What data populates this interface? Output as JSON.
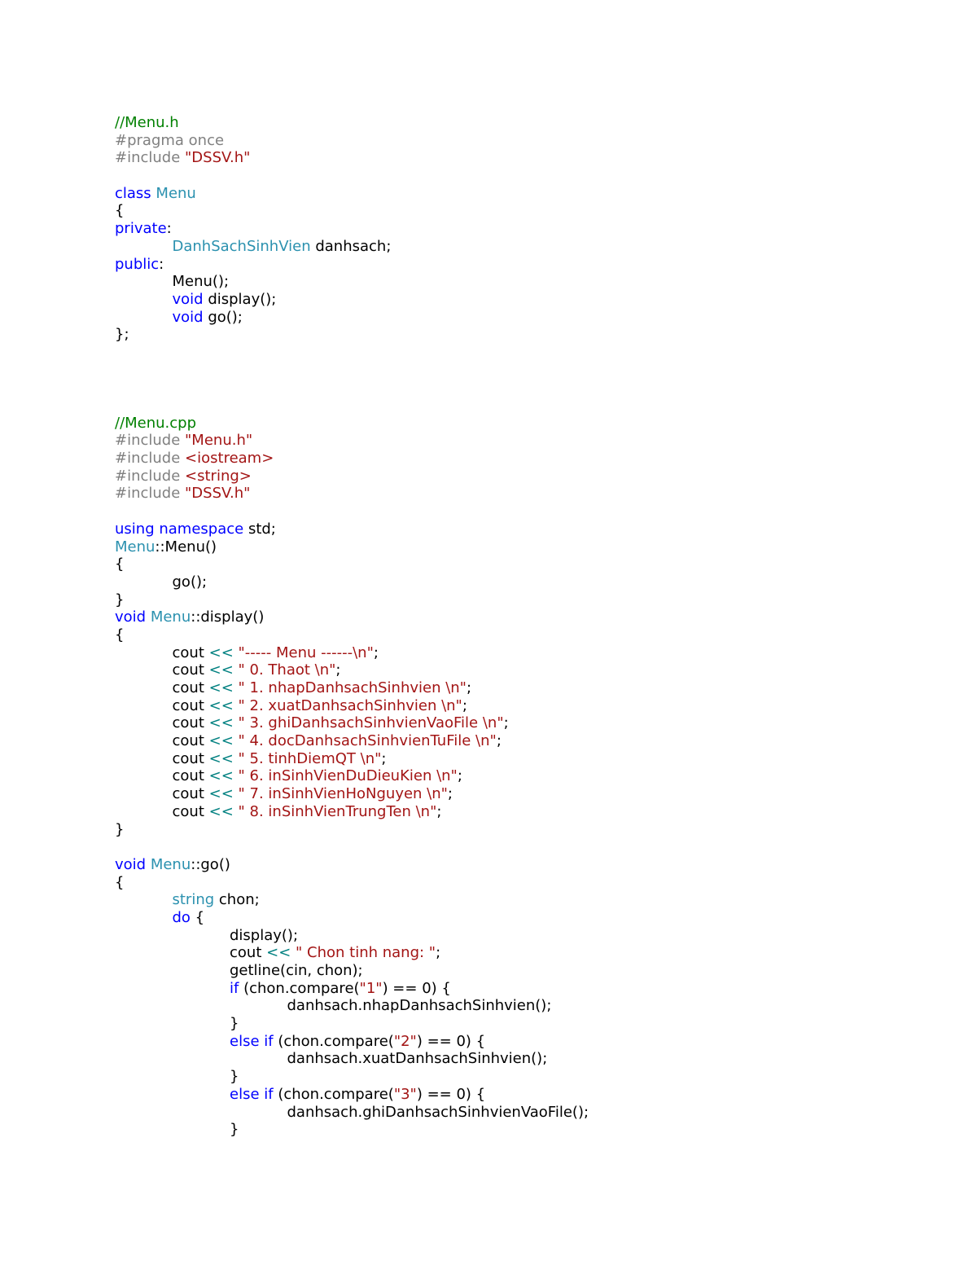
{
  "document": {
    "lines": [
      [
        {
          "t": "com",
          "s": "//Menu.h"
        }
      ],
      [
        {
          "t": "pre",
          "s": "#pragma once"
        }
      ],
      [
        {
          "t": "pre",
          "s": "#include "
        },
        {
          "t": "str",
          "s": "\"DSSV.h\""
        }
      ],
      [],
      [
        {
          "t": "kw",
          "s": "class"
        },
        {
          "t": "plain",
          "s": " "
        },
        {
          "t": "type",
          "s": "Menu"
        }
      ],
      [
        {
          "t": "plain",
          "s": "{"
        }
      ],
      [
        {
          "t": "kw",
          "s": "private"
        },
        {
          "t": "plain",
          "s": ":"
        }
      ],
      [
        {
          "t": "plain",
          "s": "\t"
        },
        {
          "t": "type",
          "s": "DanhSachSinhVien"
        },
        {
          "t": "plain",
          "s": " danhsach;"
        }
      ],
      [
        {
          "t": "kw",
          "s": "public"
        },
        {
          "t": "plain",
          "s": ":"
        }
      ],
      [
        {
          "t": "plain",
          "s": "\tMenu();"
        }
      ],
      [
        {
          "t": "plain",
          "s": "\t"
        },
        {
          "t": "kw",
          "s": "void"
        },
        {
          "t": "plain",
          "s": " display();"
        }
      ],
      [
        {
          "t": "plain",
          "s": "\t"
        },
        {
          "t": "kw",
          "s": "void"
        },
        {
          "t": "plain",
          "s": " go();"
        }
      ],
      [
        {
          "t": "plain",
          "s": "};"
        }
      ],
      [],
      [],
      [],
      [],
      [
        {
          "t": "com",
          "s": "//Menu.cpp"
        }
      ],
      [
        {
          "t": "pre",
          "s": "#include "
        },
        {
          "t": "str",
          "s": "\"Menu.h\""
        }
      ],
      [
        {
          "t": "pre",
          "s": "#include "
        },
        {
          "t": "str",
          "s": "<iostream>"
        }
      ],
      [
        {
          "t": "pre",
          "s": "#include "
        },
        {
          "t": "str",
          "s": "<string>"
        }
      ],
      [
        {
          "t": "pre",
          "s": "#include "
        },
        {
          "t": "str",
          "s": "\"DSSV.h\""
        }
      ],
      [],
      [
        {
          "t": "kw",
          "s": "using"
        },
        {
          "t": "plain",
          "s": " "
        },
        {
          "t": "kw",
          "s": "namespace"
        },
        {
          "t": "plain",
          "s": " std;"
        }
      ],
      [
        {
          "t": "type",
          "s": "Menu"
        },
        {
          "t": "plain",
          "s": "::Menu()"
        }
      ],
      [
        {
          "t": "plain",
          "s": "{"
        }
      ],
      [
        {
          "t": "plain",
          "s": "\tgo();"
        }
      ],
      [
        {
          "t": "plain",
          "s": "}"
        }
      ],
      [
        {
          "t": "kw",
          "s": "void"
        },
        {
          "t": "plain",
          "s": " "
        },
        {
          "t": "type",
          "s": "Menu"
        },
        {
          "t": "plain",
          "s": "::display()"
        }
      ],
      [
        {
          "t": "plain",
          "s": "{"
        }
      ],
      [
        {
          "t": "plain",
          "s": "\tcout "
        },
        {
          "t": "op",
          "s": "<<"
        },
        {
          "t": "plain",
          "s": " "
        },
        {
          "t": "str",
          "s": "\"----- Menu ------\\n\""
        },
        {
          "t": "plain",
          "s": ";"
        }
      ],
      [
        {
          "t": "plain",
          "s": "\tcout "
        },
        {
          "t": "op",
          "s": "<<"
        },
        {
          "t": "plain",
          "s": " "
        },
        {
          "t": "str",
          "s": "\" 0. Thaot \\n\""
        },
        {
          "t": "plain",
          "s": ";"
        }
      ],
      [
        {
          "t": "plain",
          "s": "\tcout "
        },
        {
          "t": "op",
          "s": "<<"
        },
        {
          "t": "plain",
          "s": " "
        },
        {
          "t": "str",
          "s": "\" 1. nhapDanhsachSinhvien \\n\""
        },
        {
          "t": "plain",
          "s": ";"
        }
      ],
      [
        {
          "t": "plain",
          "s": "\tcout "
        },
        {
          "t": "op",
          "s": "<<"
        },
        {
          "t": "plain",
          "s": " "
        },
        {
          "t": "str",
          "s": "\" 2. xuatDanhsachSinhvien \\n\""
        },
        {
          "t": "plain",
          "s": ";"
        }
      ],
      [
        {
          "t": "plain",
          "s": "\tcout "
        },
        {
          "t": "op",
          "s": "<<"
        },
        {
          "t": "plain",
          "s": " "
        },
        {
          "t": "str",
          "s": "\" 3. ghiDanhsachSinhvienVaoFile \\n\""
        },
        {
          "t": "plain",
          "s": ";"
        }
      ],
      [
        {
          "t": "plain",
          "s": "\tcout "
        },
        {
          "t": "op",
          "s": "<<"
        },
        {
          "t": "plain",
          "s": " "
        },
        {
          "t": "str",
          "s": "\" 4. docDanhsachSinhvienTuFile \\n\""
        },
        {
          "t": "plain",
          "s": ";"
        }
      ],
      [
        {
          "t": "plain",
          "s": "\tcout "
        },
        {
          "t": "op",
          "s": "<<"
        },
        {
          "t": "plain",
          "s": " "
        },
        {
          "t": "str",
          "s": "\" 5. tinhDiemQT \\n\""
        },
        {
          "t": "plain",
          "s": ";"
        }
      ],
      [
        {
          "t": "plain",
          "s": "\tcout "
        },
        {
          "t": "op",
          "s": "<<"
        },
        {
          "t": "plain",
          "s": " "
        },
        {
          "t": "str",
          "s": "\" 6. inSinhVienDuDieuKien \\n\""
        },
        {
          "t": "plain",
          "s": ";"
        }
      ],
      [
        {
          "t": "plain",
          "s": "\tcout "
        },
        {
          "t": "op",
          "s": "<<"
        },
        {
          "t": "plain",
          "s": " "
        },
        {
          "t": "str",
          "s": "\" 7. inSinhVienHoNguyen \\n\""
        },
        {
          "t": "plain",
          "s": ";"
        }
      ],
      [
        {
          "t": "plain",
          "s": "\tcout "
        },
        {
          "t": "op",
          "s": "<<"
        },
        {
          "t": "plain",
          "s": " "
        },
        {
          "t": "str",
          "s": "\" 8. inSinhVienTrungTen \\n\""
        },
        {
          "t": "plain",
          "s": ";"
        }
      ],
      [
        {
          "t": "plain",
          "s": "}"
        }
      ],
      [],
      [
        {
          "t": "kw",
          "s": "void"
        },
        {
          "t": "plain",
          "s": " "
        },
        {
          "t": "type",
          "s": "Menu"
        },
        {
          "t": "plain",
          "s": "::go()"
        }
      ],
      [
        {
          "t": "plain",
          "s": "{"
        }
      ],
      [
        {
          "t": "plain",
          "s": "\t"
        },
        {
          "t": "type",
          "s": "string"
        },
        {
          "t": "plain",
          "s": " chon;"
        }
      ],
      [
        {
          "t": "plain",
          "s": "\t"
        },
        {
          "t": "kw",
          "s": "do"
        },
        {
          "t": "plain",
          "s": " {"
        }
      ],
      [
        {
          "t": "plain",
          "s": "\t\tdisplay();"
        }
      ],
      [
        {
          "t": "plain",
          "s": "\t\tcout "
        },
        {
          "t": "op",
          "s": "<<"
        },
        {
          "t": "plain",
          "s": " "
        },
        {
          "t": "str",
          "s": "\" Chon tinh nang: \""
        },
        {
          "t": "plain",
          "s": ";"
        }
      ],
      [
        {
          "t": "plain",
          "s": "\t\tgetline(cin, chon);"
        }
      ],
      [
        {
          "t": "plain",
          "s": "\t\t"
        },
        {
          "t": "kw",
          "s": "if"
        },
        {
          "t": "plain",
          "s": " (chon.compare("
        },
        {
          "t": "str",
          "s": "\"1\""
        },
        {
          "t": "plain",
          "s": ") == 0) {"
        }
      ],
      [
        {
          "t": "plain",
          "s": "\t\t\tdanhsach.nhapDanhsachSinhvien();"
        }
      ],
      [
        {
          "t": "plain",
          "s": "\t\t}"
        }
      ],
      [
        {
          "t": "plain",
          "s": "\t\t"
        },
        {
          "t": "kw",
          "s": "else"
        },
        {
          "t": "plain",
          "s": " "
        },
        {
          "t": "kw",
          "s": "if"
        },
        {
          "t": "plain",
          "s": " (chon.compare("
        },
        {
          "t": "str",
          "s": "\"2\""
        },
        {
          "t": "plain",
          "s": ") == 0) {"
        }
      ],
      [
        {
          "t": "plain",
          "s": "\t\t\tdanhsach.xuatDanhsachSinhvien();"
        }
      ],
      [
        {
          "t": "plain",
          "s": "\t\t}"
        }
      ],
      [
        {
          "t": "plain",
          "s": "\t\t"
        },
        {
          "t": "kw",
          "s": "else"
        },
        {
          "t": "plain",
          "s": " "
        },
        {
          "t": "kw",
          "s": "if"
        },
        {
          "t": "plain",
          "s": " (chon.compare("
        },
        {
          "t": "str",
          "s": "\"3\""
        },
        {
          "t": "plain",
          "s": ") == 0) {"
        }
      ],
      [
        {
          "t": "plain",
          "s": "\t\t\tdanhsach.ghiDanhsachSinhvienVaoFile();"
        }
      ],
      [
        {
          "t": "plain",
          "s": "\t\t}"
        }
      ]
    ]
  }
}
